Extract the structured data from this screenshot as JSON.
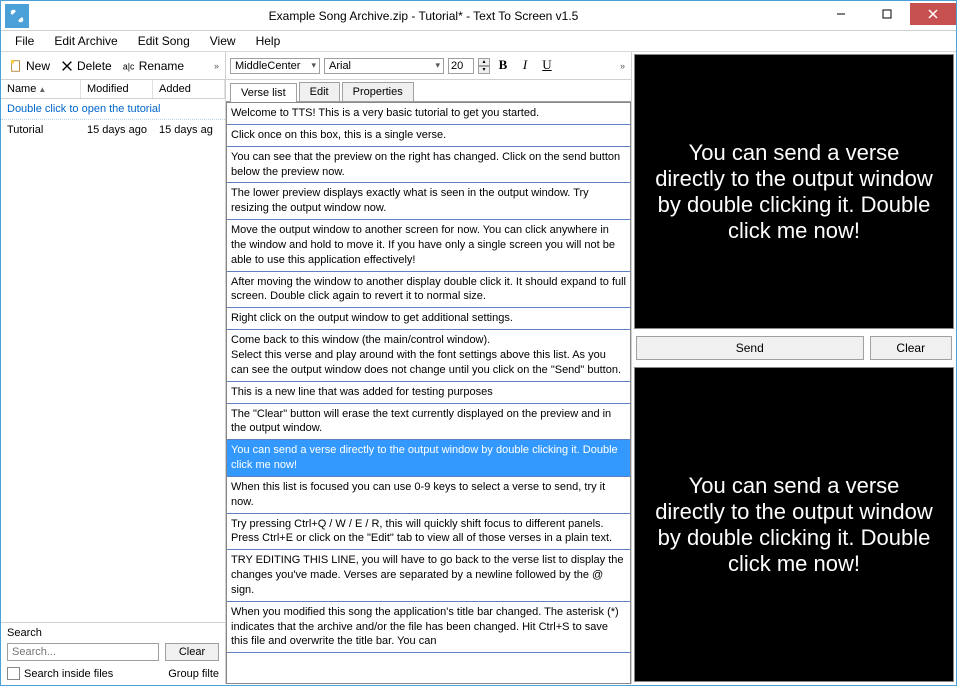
{
  "window": {
    "title": "Example Song Archive.zip - Tutorial* - Text To Screen v1.5"
  },
  "menubar": {
    "file": "File",
    "edit_archive": "Edit Archive",
    "edit_song": "Edit Song",
    "view": "View",
    "help": "Help"
  },
  "left_toolbar": {
    "new": "New",
    "delete": "Delete",
    "rename": "Rename"
  },
  "file_list": {
    "headers": {
      "name": "Name",
      "modified": "Modified",
      "added": "Added"
    },
    "hint": "Double click to open the tutorial",
    "rows": [
      {
        "name": "Tutorial",
        "modified": "15 days ago",
        "added": "15 days ag"
      }
    ]
  },
  "search": {
    "label": "Search",
    "placeholder": "Search...",
    "clear": "Clear",
    "inside_files": "Search inside files",
    "group": "Group filte"
  },
  "center_toolbar": {
    "align": "MiddleCenter",
    "font": "Arial",
    "size": "20",
    "bold": "B",
    "italic": "I",
    "underline": "U"
  },
  "tabs": {
    "verse_list": "Verse list",
    "edit": "Edit",
    "properties": "Properties"
  },
  "verses": [
    "Welcome to TTS! This is a very basic tutorial to get you started.",
    "Click once on this box, this is a single verse.",
    "You can see that the preview on the right has changed. Click on the send button below the preview now.",
    "The lower preview displays exactly what is seen in the output window. Try resizing the output window now.",
    "Move the output window to another screen for now. You can click anywhere in the window and hold to move it. If you have only a single screen you will not be able to use this application effectively!",
    "After moving the window to another display double click it. It should expand to full screen. Double click again to revert it to normal size.",
    "Right click on the output window to get additional settings.",
    "Come back to this window (the main/control window).\nSelect this verse and play around with the font settings above this list. As you can see the output window does not change until you click on the \"Send\" button.",
    "This is a new line that was added for testing purposes",
    "The \"Clear\" button will erase the text currently displayed on the preview and in the output window.",
    "You can send a verse directly to the output window by double clicking it. Double click me now!",
    "When this list is focused you can use 0-9 keys to select a verse to send, try it now.",
    "Try pressing Ctrl+Q / W / E / R, this will quickly shift focus to different panels. Press Ctrl+E or click on the \"Edit\" tab to view all of those verses in a plain text.",
    "TRY EDITING THIS LINE, you will have to go back to the verse list to display the changes you've made. Verses are separated by a newline followed by the @ sign.",
    "When you modified this song the application's title bar changed. The asterisk (*) indicates that the archive and/or the file has been changed. Hit Ctrl+S to save this file and overwrite the title bar. You can"
  ],
  "selected_verse_index": 10,
  "preview_text": "You can send a verse directly to the output window by double clicking it. Double click me now!",
  "preview_controls": {
    "send": "Send",
    "clear": "Clear"
  },
  "output_text": "You can send a verse directly to the output window by double clicking it. Double click me now!"
}
